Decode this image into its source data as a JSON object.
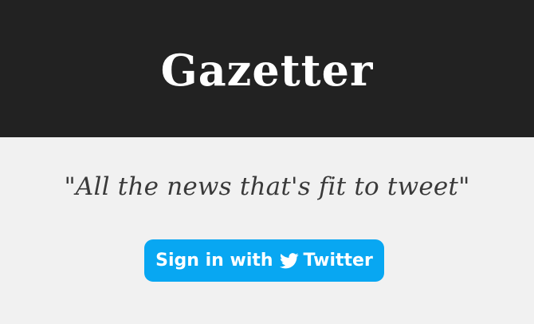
{
  "header": {
    "logo_text": "Gazetter"
  },
  "main": {
    "tagline": "\"All the news that's fit to tweet\"",
    "signin": {
      "prefix": "Sign in with",
      "suffix": "Twitter",
      "icon": "twitter-bird-icon"
    }
  },
  "colors": {
    "header_bg": "#222222",
    "page_bg": "#f1f1f1",
    "button_bg": "#08a7f2"
  }
}
